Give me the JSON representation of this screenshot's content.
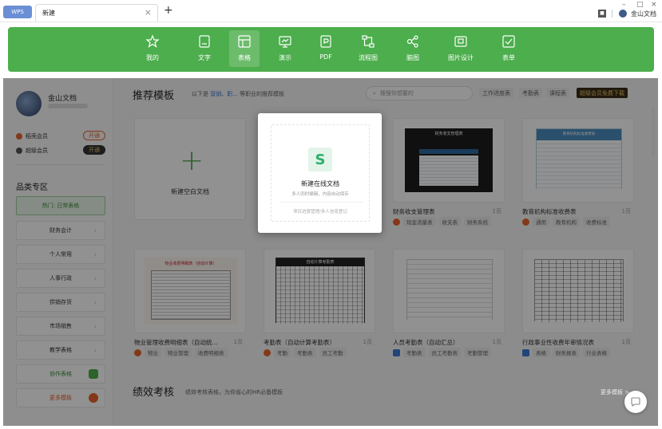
{
  "titlebar": {
    "wps_tab": "WPS",
    "doc_tab": "新建",
    "doc_tab_close": "×",
    "add_tab": "+",
    "win_min": "–",
    "win_max": "□",
    "win_close": "×",
    "user_name": "金山文档"
  },
  "toolbar": {
    "items": [
      {
        "label": "我的",
        "icon": "star-icon"
      },
      {
        "label": "文字",
        "icon": "document-icon"
      },
      {
        "label": "表格",
        "icon": "table-icon",
        "active": true
      },
      {
        "label": "演示",
        "icon": "presentation-icon"
      },
      {
        "label": "PDF",
        "icon": "pdf-icon"
      },
      {
        "label": "流程图",
        "icon": "flowchart-icon"
      },
      {
        "label": "脑图",
        "icon": "mindmap-icon"
      },
      {
        "label": "图片设计",
        "icon": "image-design-icon"
      },
      {
        "label": "表单",
        "icon": "form-icon"
      }
    ]
  },
  "sidebar": {
    "user_name": "金山文档",
    "vip": [
      {
        "label": "稻壳会员",
        "button": "开通"
      },
      {
        "label": "超级会员",
        "button": "开通"
      }
    ],
    "category_title": "品类专区",
    "items": [
      {
        "label": "热门: 日常表格"
      },
      {
        "label": "财务会计"
      },
      {
        "label": "个人常用"
      },
      {
        "label": "人事行政"
      },
      {
        "label": "供销存货"
      },
      {
        "label": "市场销售"
      },
      {
        "label": "教学表格"
      },
      {
        "label": "协作表格"
      },
      {
        "label": "更多模板"
      }
    ]
  },
  "recommend": {
    "title": "推荐模板",
    "desc_prefix": "以下是",
    "desc_link": "营销、职...",
    "desc_suffix": "等职业的推荐模板",
    "search_placeholder": "搜搜你想要的",
    "chips": [
      "工作进度表",
      "考勤表",
      "课程表"
    ],
    "vip_chip": "超级会员免费下载"
  },
  "blank_card": {
    "label": "新建空白文档"
  },
  "online_card": {
    "icon_letter": "S",
    "title": "新建在线文档",
    "subtitle": "多人同时编辑，内容自动保存",
    "note": "项目进度管理/多人信息登记"
  },
  "cards": [
    {
      "title": "财务收支管理表",
      "pages": "1页",
      "tags": [
        "现金流量表",
        "收支表",
        "财务系统"
      ],
      "thumb_title": "财务收支管理表"
    },
    {
      "title": "教育机构标准收费表",
      "pages": "1页",
      "tags": [
        "通用",
        "教育机构",
        "收费标准"
      ],
      "thumb_title": "教育机构标准收费表"
    },
    {
      "title": "物业管理收费明细表（自动统...",
      "pages": "1页",
      "tags": [
        "物业",
        "物业管理",
        "收费明细表"
      ],
      "thumb_title": "物业收费明细表（自动计算）"
    },
    {
      "title": "考勤表（自动计算考勤表）",
      "pages": "1页",
      "tags": [
        "考勤",
        "考勤表",
        "员工考勤"
      ],
      "thumb_title": "自动计算考勤表"
    },
    {
      "title": "人员考勤表（自动汇总）",
      "pages": "1页",
      "tags": [
        "考勤表",
        "员工考勤表",
        "考勤管理"
      ],
      "thumb_title": ""
    },
    {
      "title": "行政事业性收费年审情况表",
      "pages": "1页",
      "tags": [
        "表格",
        "财务报表",
        "行业表格"
      ],
      "thumb_title": ""
    }
  ],
  "perf": {
    "title": "绩效考核",
    "desc": "绩效考核表格，为你省心的HR必备模板",
    "more": "更多模板 >"
  },
  "colors": {
    "toolbar_green": "#4cae4c",
    "accent_green": "#2bb06a",
    "wps_blue": "#6a8fd4",
    "vip_dark": "#3a2d18",
    "vip_gold": "#e8c66a",
    "link_blue": "#3a7bd5"
  }
}
